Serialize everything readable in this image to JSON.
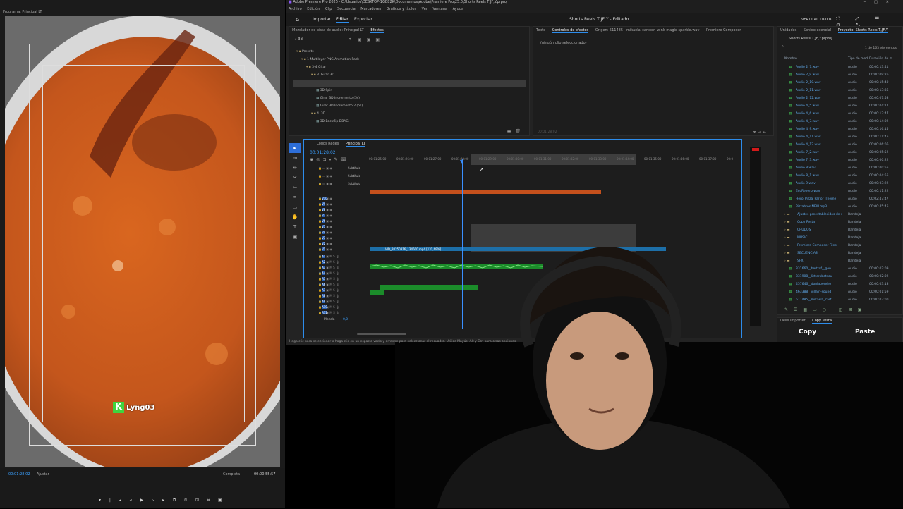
{
  "program": {
    "tab": "Programa: Principal LT",
    "watermark": "Lyng03",
    "timecode_left": "00:01:28:02",
    "fit": "Ajustar",
    "quality": "Completa",
    "timecode_right": "00:00:55:57"
  },
  "app": {
    "title": "Adobe Premiere Pro 2025 - C:\\Usuarios\\DESKTOP-1GB82K\\Documentos\\Adobe\\Premiere Pro\\25.0\\Shorts Reels T,JF,Y.prproj",
    "menu": [
      "Archivo",
      "Edición",
      "Clip",
      "Secuencia",
      "Marcadores",
      "Gráficos y títulos",
      "Ver",
      "Ventana",
      "Ayuda"
    ],
    "workspace_tabs": [
      "Importar",
      "Editar",
      "Exportar"
    ],
    "project_title": "Shorts Reels T,JF,Y - Editado",
    "workspace_name": "VERTICAL TIKTOK"
  },
  "effects_panel": {
    "tabs": [
      "Mezclador de pista de audio: Principal LT",
      "Efectos"
    ],
    "search": "3d",
    "tree": [
      {
        "label": "Presets",
        "indent": 0
      },
      {
        "label": "1 Multilayer PNG Animation Pack",
        "indent": 1
      },
      {
        "label": "3-4 Girar",
        "indent": 2
      },
      {
        "label": "3. Girar 3D",
        "indent": 3
      },
      {
        "label": "3D Backflip DBAG",
        "indent": 4
      },
      {
        "label": "3D Spin",
        "indent": 4
      },
      {
        "label": "Girar 3D Incremento (5s)",
        "indent": 4
      },
      {
        "label": "Girar 3D Incremento 2 (5s)",
        "indent": 4
      },
      {
        "label": "4. 3D",
        "indent": 3
      },
      {
        "label": "3D Backflip DBAG",
        "indent": 4
      }
    ]
  },
  "effect_controls": {
    "tabs": [
      "Texto",
      "Controles de efectos",
      "Origen: 511485__mikaela_cartoon-wink-magic-sparkle.wav",
      "Premiere Composer"
    ],
    "empty": "(ningún clip seleccionado)",
    "timecode": "00:01:28:02"
  },
  "project_panel": {
    "tabs": [
      "Unidades",
      "Sonido esencial",
      "Proyecto: Shorts Reels T,JF,Y"
    ],
    "name": "Shorts Reels T,JF,Y.prproj",
    "count": "1 de 163 elementos",
    "col_name": "Nombre",
    "col_type": "Tipo de medi",
    "col_dur": "Duración de m",
    "items": [
      {
        "name": "Audio 2_7.wav",
        "type": "Audio",
        "dur": "00:00:13:41"
      },
      {
        "name": "Audio 2_9.wav",
        "type": "Audio",
        "dur": "00:00:09:26"
      },
      {
        "name": "Audio 2_10.wav",
        "type": "Audio",
        "dur": "00:00:15:40"
      },
      {
        "name": "Audio 2_11.wav",
        "type": "Audio",
        "dur": "00:00:13:36"
      },
      {
        "name": "Audio 2_12.wav",
        "type": "Audio",
        "dur": "00:00:07:53"
      },
      {
        "name": "Audio 4_5.wav",
        "type": "Audio",
        "dur": "00:00:04:17"
      },
      {
        "name": "Audio 4_6.wav",
        "type": "Audio",
        "dur": "00:00:13:47"
      },
      {
        "name": "Audio 4_7.wav",
        "type": "Audio",
        "dur": "00:00:14:02"
      },
      {
        "name": "Audio 4_9.wav",
        "type": "Audio",
        "dur": "00:00:16:15"
      },
      {
        "name": "Audio 4_11.wav",
        "type": "Audio",
        "dur": "00:00:11:45"
      },
      {
        "name": "Audio 4_12.wav",
        "type": "Audio",
        "dur": "00:00:06:06"
      },
      {
        "name": "Audio 7_2.wav",
        "type": "Audio",
        "dur": "00:00:05:52"
      },
      {
        "name": "Audio 7_3.wav",
        "type": "Audio",
        "dur": "00:00:00:22"
      },
      {
        "name": "Audio 8.wav",
        "type": "Audio",
        "dur": "00:00:00:55"
      },
      {
        "name": "Audio 8_1.wav",
        "type": "Audio",
        "dur": "00:00:04:55"
      },
      {
        "name": "Audio 9.wav",
        "type": "Audio",
        "dur": "00:00:03:22"
      },
      {
        "name": "EcoReverb.wav",
        "type": "Audio",
        "dur": "00:00:11:22"
      },
      {
        "name": "Hero_Pizza_Parlor_Theme_",
        "type": "Audio",
        "dur": "00:02:47:47"
      },
      {
        "name": "Pizzabros NEW.mp3",
        "type": "Audio",
        "dur": "00:00:45:45"
      },
      {
        "name": "Ajustes preestablecidos de s",
        "type": "Bandeja",
        "dur": ""
      },
      {
        "name": "Copy Pesta",
        "type": "Bandeja",
        "dur": ""
      },
      {
        "name": "CRUDOS",
        "type": "Bandeja",
        "dur": ""
      },
      {
        "name": "MUSIC",
        "type": "Bandeja",
        "dur": ""
      },
      {
        "name": "Premiere Composer Files",
        "type": "Bandeja",
        "dur": ""
      },
      {
        "name": "SECUENCIAS",
        "type": "Bandeja",
        "dur": ""
      },
      {
        "name": "SFX",
        "type": "Bandeja",
        "dur": ""
      },
      {
        "name": "331660__bertrof__gen",
        "type": "Audio",
        "dur": "00:00:02:09"
      },
      {
        "name": "331908__littlerobotsou",
        "type": "Audio",
        "dur": "00:00:02:02"
      },
      {
        "name": "457646__doniapereiro",
        "type": "Audio",
        "dur": "00:00:03:13"
      },
      {
        "name": "463388__villain-sound_",
        "type": "Audio",
        "dur": "00:00:01:59"
      },
      {
        "name": "511485__mikaela_cart",
        "type": "Audio",
        "dur": "00:00:03:00"
      }
    ],
    "bottom_tabs": [
      "Dewl importer",
      "Copy Pesta"
    ],
    "copy": "Copy",
    "paste": "Paste"
  },
  "timeline": {
    "tabs": [
      "Logos Redes",
      "Principal LT"
    ],
    "timecode": "00:01:28:02",
    "ruler": [
      "00:01:25:00",
      "00:01:26:00",
      "00:01:27:00",
      "00:01:28:00",
      "00:01:29:00",
      "00:01:30:00",
      "00:01:31:00",
      "00:01:32:00",
      "00:01:33:00",
      "00:01:34:00",
      "00:01:35:00",
      "00:01:36:00",
      "00:01:37:00",
      "00:0"
    ],
    "subtitle_tracks": [
      "Subtítulo",
      "Subtítulo",
      "Subtítulo"
    ],
    "video_tracks": [
      "V10",
      "V9",
      "V8",
      "V7",
      "V6",
      "V5",
      "V4",
      "V3",
      "V2",
      "V1"
    ],
    "audio_tracks": [
      "A1",
      "A2",
      "A3",
      "A4",
      "A5",
      "A6",
      "A7",
      "A8",
      "A9",
      "A10",
      "A11"
    ],
    "mix_label": "Mezcla",
    "mix_value": "0,0",
    "clip_label": "VID_20250316_134600.mp4 [131,69%]"
  },
  "status_text": "Haga clic para seleccionar o haga clic en un espacio vacío y arrastre para seleccionar el recuadro. Utilice Mayús, Alt y Ctrl para otras opciones."
}
